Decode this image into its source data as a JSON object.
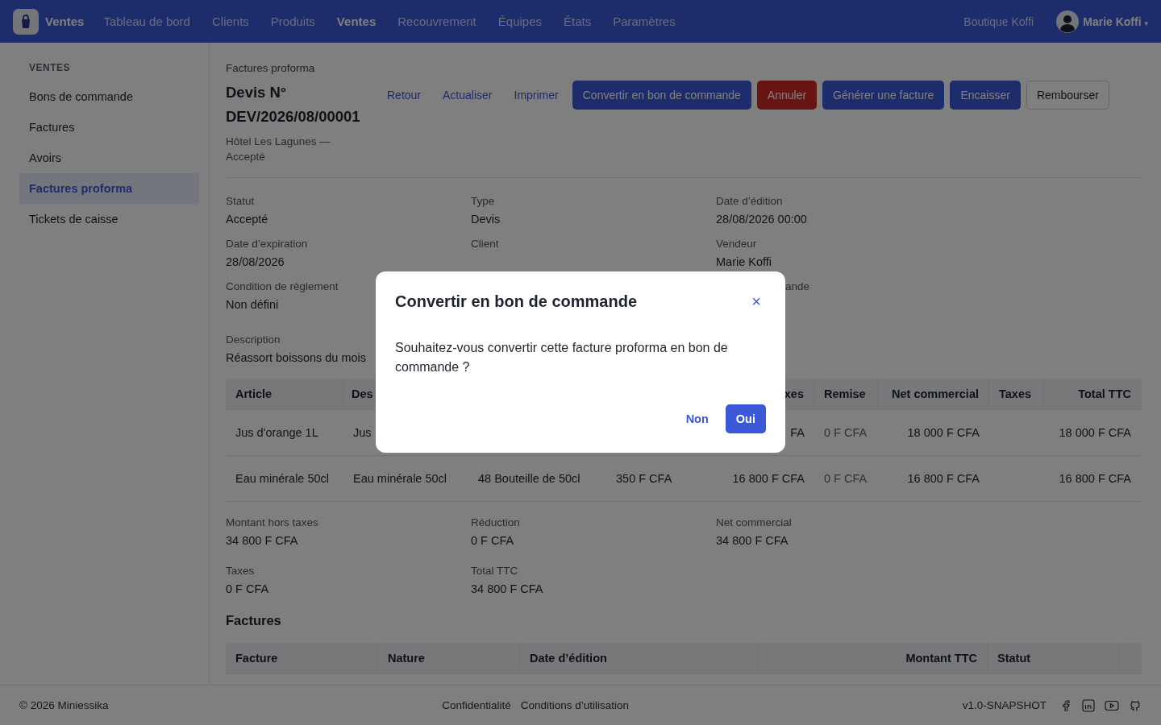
{
  "nav": {
    "brand": "Ventes",
    "items": [
      {
        "label": "Tableau de bord",
        "selected": false
      },
      {
        "label": "Clients",
        "selected": false
      },
      {
        "label": "Produits",
        "selected": false
      },
      {
        "label": "Ventes",
        "selected": true
      },
      {
        "label": "Recouvrement",
        "selected": false
      },
      {
        "label": "Équipes",
        "selected": false
      },
      {
        "label": "États",
        "selected": false
      },
      {
        "label": "Paramètres",
        "selected": false
      }
    ],
    "shop": "Boutique Koffi",
    "user": "Marie Koffi",
    "caret": "▾"
  },
  "sidebar": {
    "heading": "VENTES",
    "items": [
      {
        "label": "Bons de commande",
        "selected": false
      },
      {
        "label": "Factures",
        "selected": false
      },
      {
        "label": "Avoirs",
        "selected": false
      },
      {
        "label": "Factures proforma",
        "selected": true
      },
      {
        "label": "Tickets de caisse",
        "selected": false
      }
    ]
  },
  "breadcrumb": "Factures proforma",
  "title": "Devis N° DEV/2026/08/00001",
  "subtitle": "Hôtel Les Lagunes — Accepté",
  "actions": [
    {
      "label": "Retour",
      "kind": "link"
    },
    {
      "label": "Actualiser",
      "kind": "link"
    },
    {
      "label": "Imprimer",
      "kind": "link"
    },
    {
      "label": "Convertir en bon de commande",
      "kind": "primary"
    },
    {
      "label": "Annuler",
      "kind": "danger"
    },
    {
      "label": "Générer une facture",
      "kind": "primary"
    },
    {
      "label": "Encaisser",
      "kind": "primary"
    },
    {
      "label": "Rembourser",
      "kind": "outline"
    }
  ],
  "fields": [
    [
      {
        "label": "Statut",
        "value": "Accepté"
      },
      {
        "label": "Type",
        "value": "Devis"
      },
      {
        "label": "Date d’édition",
        "value": "28/08/2026 00:00"
      }
    ],
    [
      {
        "label": "Date d’expiration",
        "value": "28/08/2026"
      },
      {
        "label": "Client"
      },
      {
        "label": "Vendeur",
        "value": "Marie Koffi"
      }
    ],
    [
      {
        "label": "Condition de règlement",
        "value": "Non défini"
      },
      {
        "label": "ande"
      }
    ]
  ],
  "description": {
    "label": "Description",
    "value": "Réassort boissons du mois"
  },
  "lines": {
    "columns": [
      "Article",
      "Des",
      null,
      null,
      "xes",
      "Remise",
      "Net commercial",
      "Taxes",
      "Total TTC"
    ],
    "rows": [
      [
        "Jus d'orange 1L",
        "Jus",
        null,
        null,
        "FA",
        "0 F CFA",
        "18 000 F CFA",
        null,
        "18 000 F CFA"
      ],
      [
        "Eau minérale 50cl",
        "Eau minérale 50cl",
        "48 Bouteille de 50cl",
        "350 F CFA",
        "16 800 F CFA",
        "0 F CFA",
        "16 800 F CFA",
        null,
        "16 800 F CFA"
      ]
    ]
  },
  "totals": [
    [
      {
        "label": "Montant hors taxes",
        "value": "34 800 F CFA"
      },
      {
        "label": "Réduction",
        "value": "0 F CFA"
      },
      {
        "label": "Net commercial",
        "value": "34 800 F CFA"
      }
    ],
    [
      {
        "label": "Taxes",
        "value": "0 F CFA"
      },
      {
        "label": "Total TTC",
        "value": "34 800 F CFA"
      }
    ]
  ],
  "invoices": {
    "heading": "Factures",
    "columns": [
      "Facture",
      "Nature",
      "Date d’édition",
      "Montant TTC",
      "Statut"
    ]
  },
  "footer": {
    "copyright": "© 2026 Miniessika",
    "links": [
      "Confidentialité",
      "Conditions d’utilisation"
    ],
    "version": "v1.0-SNAPSHOT"
  },
  "dialog": {
    "title": "Convertir en bon de commande",
    "close": "×",
    "message": "Souhaitez-vous convertir cette facture proforma en bon de commande ?",
    "buttons": [
      {
        "label": "Non",
        "kind": "link"
      },
      {
        "label": "Oui",
        "kind": "primary"
      }
    ]
  }
}
